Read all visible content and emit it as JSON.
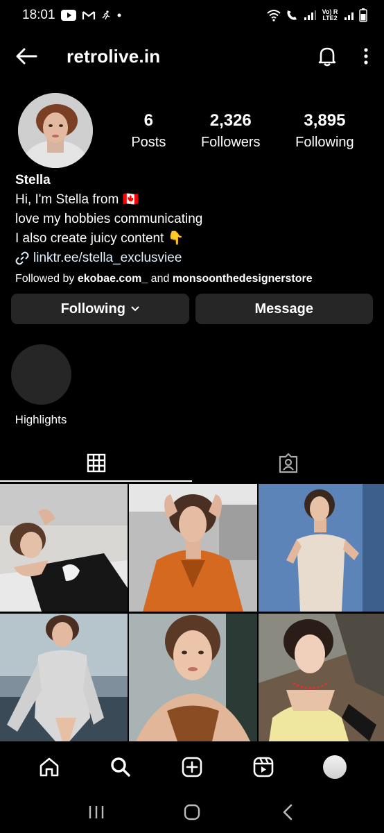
{
  "status_bar": {
    "time": "18:01",
    "right_text": "Vo) R LTE2"
  },
  "header": {
    "title": "retrolive.in",
    "back_icon": "arrow-left-icon",
    "bell_icon": "bell-icon",
    "more_icon": "more-vertical-icon"
  },
  "profile": {
    "stats": [
      {
        "value": "6",
        "label": "Posts"
      },
      {
        "value": "2,326",
        "label": "Followers"
      },
      {
        "value": "3,895",
        "label": "Following"
      }
    ],
    "name": "Stella",
    "bio_lines": [
      "Hi, I'm Stella from 🇨🇦",
      "love my hobbies communicating",
      "I also create juicy content 👇"
    ],
    "link": "linktr.ee/stella_exclusviee",
    "followed_by_prefix": "Followed by ",
    "followed_by_1": "ekobae.com_",
    "followed_by_and": " and ",
    "followed_by_2": "monsoonthedesignerstore"
  },
  "actions": {
    "following_label": "Following",
    "message_label": "Message"
  },
  "highlights": [
    {
      "label": "Highlights"
    }
  ],
  "tabs": [
    {
      "icon": "grid-icon",
      "active": true
    },
    {
      "icon": "tagged-icon",
      "active": false
    }
  ],
  "bottom_nav": [
    "home-icon",
    "search-icon",
    "create-icon",
    "reels-icon",
    "profile-avatar"
  ],
  "colors": {
    "background": "#000000",
    "button": "#262626",
    "text": "#ffffff"
  }
}
